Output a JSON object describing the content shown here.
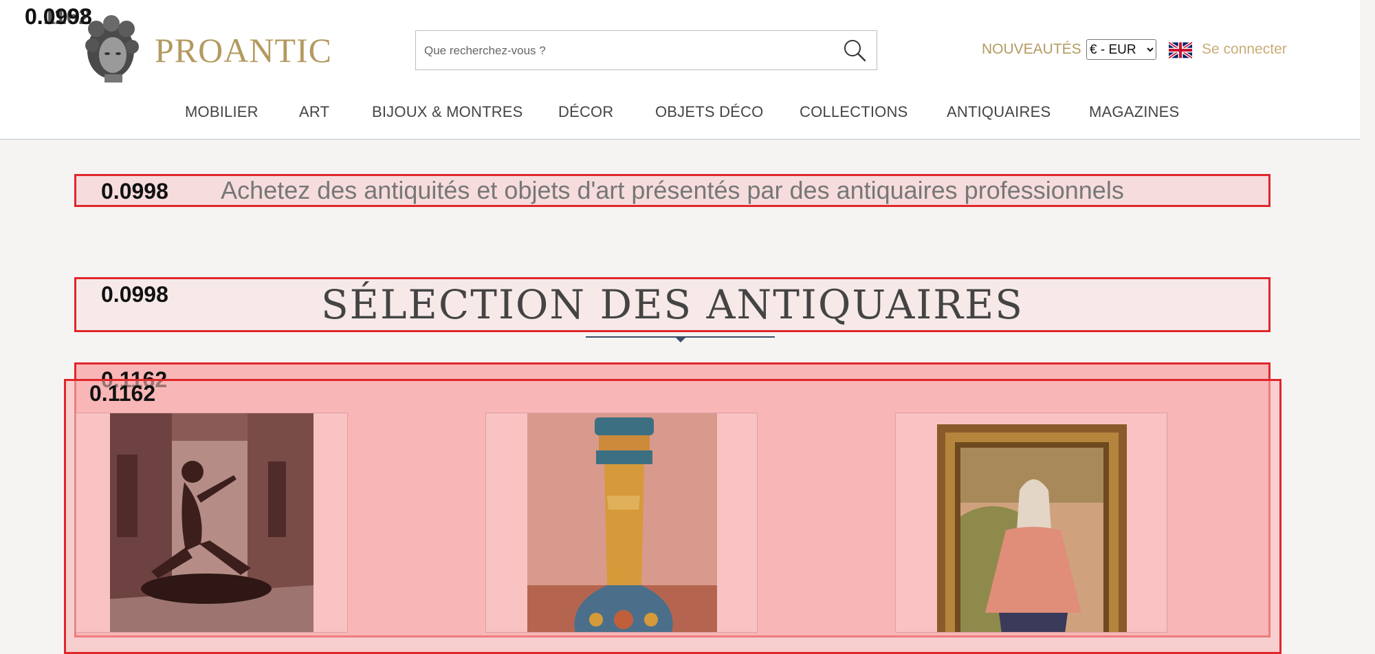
{
  "overlay_scores": {
    "corner": "0.0998",
    "corner_b": "0.1162",
    "banner": "0.0998",
    "section": "0.0998",
    "grid_top": "0.1162",
    "grid_inner": "0.1162"
  },
  "brand": {
    "name": "PROANTIC",
    "color": "#b39a5f"
  },
  "search": {
    "placeholder": "Que recherchez-vous ?",
    "value": ""
  },
  "header_links": {
    "new_label": "NOUVEAUTÉS",
    "login_label": "Se connecter"
  },
  "currency": {
    "selected": "€ - EUR",
    "options": [
      "€ - EUR"
    ]
  },
  "language_flag": "uk-flag-icon",
  "nav": {
    "items": [
      {
        "label": "MOBILIER"
      },
      {
        "label": "ART"
      },
      {
        "label": "BIJOUX & MONTRES"
      },
      {
        "label": "DÉCOR"
      },
      {
        "label": "OBJETS DÉCO"
      },
      {
        "label": "COLLECTIONS"
      },
      {
        "label": "ANTIQUAIRES"
      },
      {
        "label": "MAGAZINES"
      }
    ]
  },
  "tagline": "Achetez des antiquités et objets d'art présentés par des antiquaires professionnels",
  "section_title": "SÉLECTION DES ANTIQUAIRES",
  "products": [
    {
      "image": "bronze-sculpture-image"
    },
    {
      "image": "enamel-vase-image"
    },
    {
      "image": "framed-painting-image"
    }
  ],
  "colors": {
    "accent": "#b39a5f",
    "highlight_border": "#e0262b",
    "highlight_fill": "#f8b6b6"
  }
}
